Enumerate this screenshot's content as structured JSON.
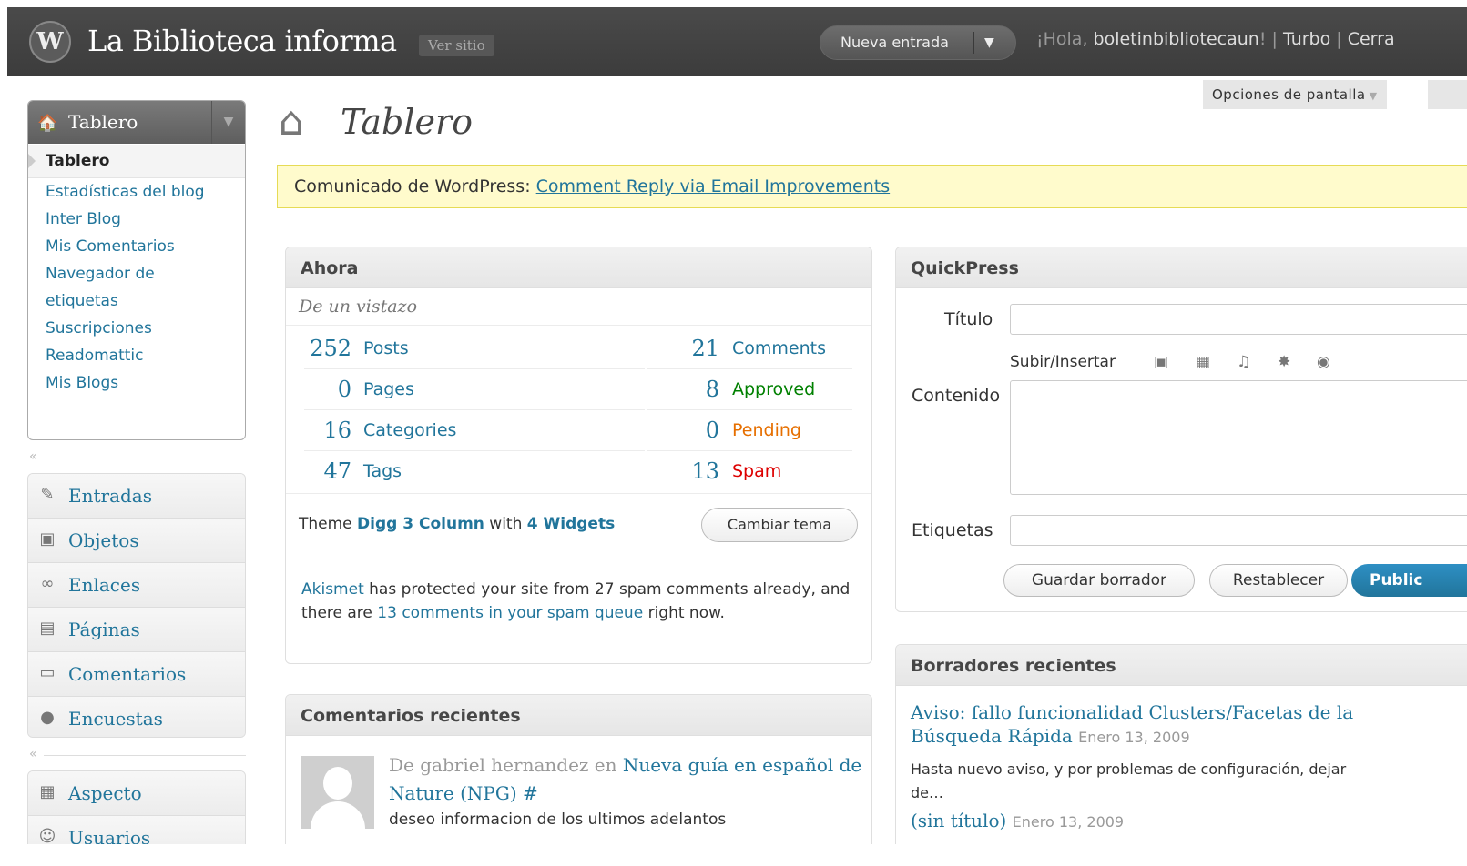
{
  "header": {
    "logo": "W",
    "site_title": "La Biblioteca informa",
    "view_site": "Ver sitio",
    "new_post": "Nueva entrada",
    "greeting_prefix": "¡Hola, ",
    "username": "boletinbibliotecaun",
    "greeting_suffix": "!",
    "sep1": " | ",
    "turbo": "Turbo",
    "sep2": " | ",
    "logout": "Cerra"
  },
  "screen_options": "Opciones de pantalla",
  "sidebar": {
    "dashboard_label": "Tablero",
    "dashboard_sub": [
      "Tablero",
      "Estadísticas del blog",
      "Inter Blog",
      "Mis Comentarios",
      "Navegador de etiquetas",
      "Suscripciones",
      "Readomattic",
      "Mis Blogs"
    ],
    "group1": [
      {
        "label": "Entradas",
        "icon": "pin-icon"
      },
      {
        "label": "Objetos",
        "icon": "media-icon"
      },
      {
        "label": "Enlaces",
        "icon": "link-icon"
      },
      {
        "label": "Páginas",
        "icon": "pages-icon"
      },
      {
        "label": "Comentarios",
        "icon": "comments-icon"
      },
      {
        "label": "Encuestas",
        "icon": "polls-icon"
      }
    ],
    "group2": [
      {
        "label": "Aspecto",
        "icon": "appearance-icon"
      },
      {
        "label": "Usuarios",
        "icon": "users-icon"
      }
    ]
  },
  "page": {
    "title": "Tablero",
    "notice_prefix": "Comunicado de WordPress: ",
    "notice_link": "Comment Reply via Email Improvements"
  },
  "ahora": {
    "title": "Ahora",
    "subtitle": "De un vistazo",
    "content_stats": [
      {
        "num": "252",
        "label": "Posts"
      },
      {
        "num": "0",
        "label": "Pages"
      },
      {
        "num": "16",
        "label": "Categories"
      },
      {
        "num": "47",
        "label": "Tags"
      }
    ],
    "comment_stats": [
      {
        "num": "21",
        "label": "Comments",
        "color": "#21759b"
      },
      {
        "num": "8",
        "label": "Approved",
        "color": "#008000"
      },
      {
        "num": "0",
        "label": "Pending",
        "color": "#e66f00"
      },
      {
        "num": "13",
        "label": "Spam",
        "color": "#dd0000"
      }
    ],
    "theme_prefix": "Theme ",
    "theme_name": "Digg 3 Column",
    "theme_mid": " with ",
    "widgets_link": "4 Widgets",
    "change_theme": "Cambiar tema",
    "akismet_link": "Akismet",
    "akismet_text1": " has protected your site from 27 spam comments already, and there are ",
    "akismet_queue_link": "13 comments in your spam queue",
    "akismet_text2": " right now."
  },
  "recent_comments": {
    "title": "Comentarios recientes",
    "author_prefix": "De gabriel hernandez en ",
    "post_link": "Nueva guía en español de Nature (NPG) #",
    "text": "deseo informacion de los ultimos adelantos"
  },
  "quickpress": {
    "title": "QuickPress",
    "title_label": "Título",
    "upload_label": "Subir/Insertar",
    "content_label": "Contenido",
    "tags_label": "Etiquetas",
    "save_draft": "Guardar borrador",
    "reset": "Restablecer",
    "publish": "Public"
  },
  "drafts": {
    "title": "Borradores recientes",
    "items": [
      {
        "title": "Aviso: fallo funcionalidad Clusters/Facetas de la Búsqueda Rápida",
        "date": "Enero 13, 2009"
      },
      {
        "title": "(sin título)",
        "date": "Enero 13, 2009"
      }
    ],
    "excerpt_line1": "Hasta nuevo aviso, y por problemas de configuración, dejar",
    "excerpt_line2": "de…"
  }
}
